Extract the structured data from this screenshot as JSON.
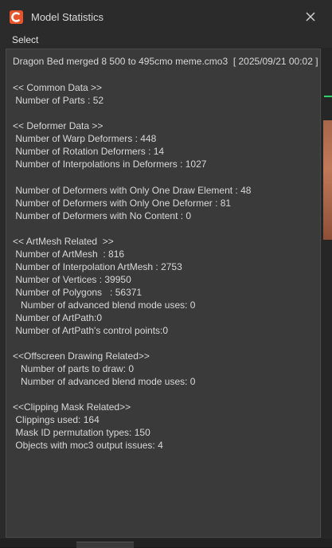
{
  "window": {
    "title": "Model Statistics",
    "close_glyph": "✕",
    "accent_color": "#e8542a"
  },
  "menu": {
    "select_label": "Select"
  },
  "stats": {
    "header": "Dragon Bed merged 8 500 to 495cmo meme.cmo3  [ 2025/09/21 00:02 ]",
    "common_header": "<< Common Data >>",
    "parts": " Number of Parts : 52",
    "deformer_header": "<< Deformer Data >>",
    "warp": " Number of Warp Deformers : 448",
    "rotation": " Number of Rotation Deformers : 14",
    "interpolations": " Number of Interpolations in Deformers : 1027",
    "one_draw": " Number of Deformers with Only One Draw Element : 48",
    "one_deformer": " Number of Deformers with Only One Deformer : 81",
    "no_content": " Number of Deformers with No Content : 0",
    "artmesh_header": "<< ArtMesh Related  >>",
    "artmesh": " Number of ArtMesh  : 816",
    "interp_artmesh": " Number of Interpolation ArtMesh : 2753",
    "vertices": " Number of Vertices : 39950",
    "polygons": " Number of Polygons   : 56371",
    "blend_uses_1": "   Number of advanced blend mode uses: 0",
    "artpath": " Number of ArtPath:0",
    "artpath_points": " Number of ArtPath's control points:0",
    "offscreen_header": "<<Offscreen Drawing Related>>",
    "parts_to_draw": "   Number of parts to draw: 0",
    "blend_uses_2": "   Number of advanced blend mode uses: 0",
    "clipping_header": "<<Clipping Mask Related>>",
    "clippings": " Clippings used: 164",
    "mask_perm": " Mask ID permutation types: 150",
    "moc3_issues": " Objects with moc3 output issues: 4"
  }
}
